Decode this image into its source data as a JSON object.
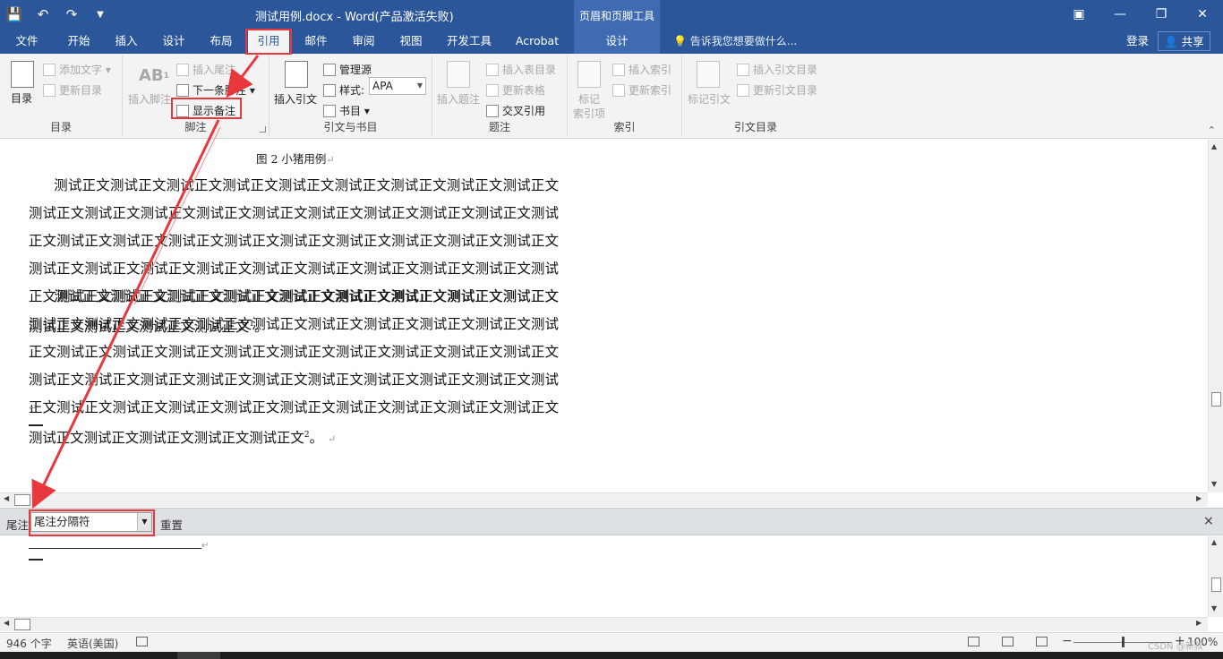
{
  "title_bar": {
    "doc_title": "测试用例.docx - Word(产品激活失败)",
    "context_title": "页眉和页脚工具"
  },
  "tabs": [
    "文件",
    "开始",
    "插入",
    "设计",
    "布局",
    "引用",
    "邮件",
    "审阅",
    "视图",
    "开发工具",
    "Acrobat"
  ],
  "active_tab": "引用",
  "context_tab": "设计",
  "tell_me": "告诉我您想要做什么...",
  "account": {
    "login": "登录",
    "share": "共享"
  },
  "ribbon": {
    "toc": {
      "label": "目录",
      "big_button": "目录",
      "add_text": "添加文字",
      "update_toc": "更新目录"
    },
    "footnotes": {
      "label": "脚注",
      "insert_footnote": "插入脚注",
      "insert_endnote": "插入尾注",
      "next_footnote": "下一条脚注",
      "show_notes": "显示备注"
    },
    "citations": {
      "label": "引文与书目",
      "insert_citation": "插入引文",
      "manage_sources": "管理源",
      "style_label": "样式:",
      "style_value": "APA",
      "bibliography": "书目"
    },
    "captions": {
      "label": "题注",
      "insert_caption": "插入题注",
      "insert_tof": "插入表目录",
      "update_table": "更新表格",
      "cross_ref": "交叉引用"
    },
    "index": {
      "label": "索引",
      "mark_entry_1": "标记",
      "mark_entry_2": "索引项",
      "insert_index": "插入索引",
      "update_index": "更新索引"
    },
    "toa": {
      "label": "引文目录",
      "mark_citation": "标记引文",
      "insert_toa": "插入引文目录",
      "update_toa": "更新引文目录"
    }
  },
  "document": {
    "caption": "图 2  小猪用例",
    "para1": "测试正文测试正文测试正文测试正文测试正文测试正文测试正文测试正文测试正文测试正文测试正文测试正文测试正文测试正文测试正文测试正文测试正文测试正文测试正文测试正文测试正文测试正文测试正文测试正文测试正文测试正文测试正文测试正文测试正文测试正文测试正文测试正文测试正文测试正文测试正文测试正文测试正文测试正文测试正文测试正文测试正文测试正文测试正文测试正文测试正文测试正文测试正文测试正文测试正文测试正文测试正文",
    "para1_sup": "1",
    "para1_end": "。",
    "para2": "测试正文测试正文测试正文测试正文测试正文测试正文测试正文测试正文测试正文测试正文测试正文测试正文测试正文测试正文测试正文测试正文测试正文测试正文测试正文测试正文测试正文测试正文测试正文测试正文测试正文测试正文测试正文测试正文测试正文测试正文测试正文测试正文测试正文测试正文测试正文测试正文测试正文测试正文测试正文测试正文测试正文测试正文测试正文测试正文测试正文测试正文测试正文测试正文测试正文测试正文测试正文测试正文",
    "para2_sup": "2",
    "para2_end": "。",
    "return_mark": "↵"
  },
  "notes_pane": {
    "label": "尾注",
    "select_value": "尾注分隔符",
    "reset": "重置",
    "close": "×"
  },
  "status_bar": {
    "word_count": "946 个字",
    "language": "英语(美国)",
    "zoom": "100%"
  },
  "watermark": "CSDN @新叔",
  "zoom_level_fraction": 0.5,
  "colors": {
    "title_blue": "#2b579a",
    "context_blue": "#3e6bb2",
    "highlight_red": "#e8383d"
  }
}
